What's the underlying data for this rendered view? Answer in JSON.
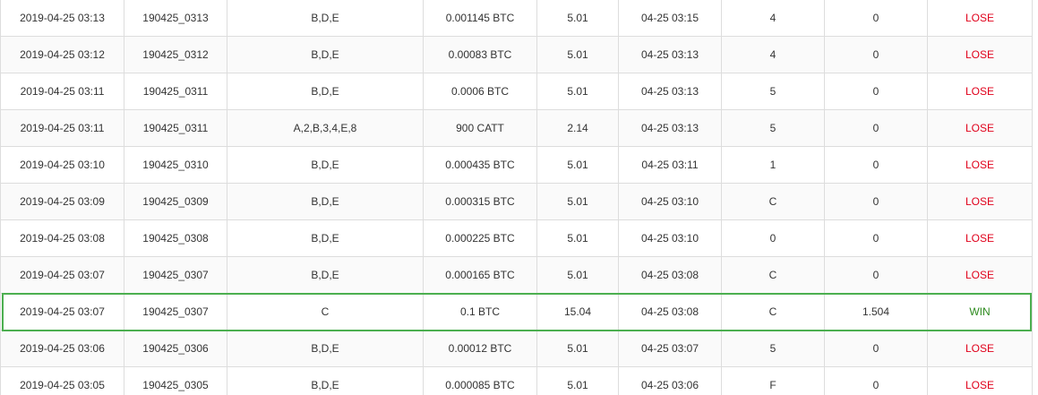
{
  "colors": {
    "lose": "#e0001b",
    "win": "#2e8b1f",
    "highlight_border": "#4caf50",
    "grid": "#dddddd"
  },
  "rows": [
    {
      "time": "2019-04-25 03:13",
      "round": "190425_0313",
      "bet": "B,D,E",
      "amount": "0.001145 BTC",
      "odds": "5.01",
      "draw_time": "04-25 03:15",
      "number": "4",
      "payout": "0",
      "result": "LOSE"
    },
    {
      "time": "2019-04-25 03:12",
      "round": "190425_0312",
      "bet": "B,D,E",
      "amount": "0.00083 BTC",
      "odds": "5.01",
      "draw_time": "04-25 03:13",
      "number": "4",
      "payout": "0",
      "result": "LOSE"
    },
    {
      "time": "2019-04-25 03:11",
      "round": "190425_0311",
      "bet": "B,D,E",
      "amount": "0.0006 BTC",
      "odds": "5.01",
      "draw_time": "04-25 03:13",
      "number": "5",
      "payout": "0",
      "result": "LOSE"
    },
    {
      "time": "2019-04-25 03:11",
      "round": "190425_0311",
      "bet": "A,2,B,3,4,E,8",
      "amount": "900 CATT",
      "odds": "2.14",
      "draw_time": "04-25 03:13",
      "number": "5",
      "payout": "0",
      "result": "LOSE"
    },
    {
      "time": "2019-04-25 03:10",
      "round": "190425_0310",
      "bet": "B,D,E",
      "amount": "0.000435 BTC",
      "odds": "5.01",
      "draw_time": "04-25 03:11",
      "number": "1",
      "payout": "0",
      "result": "LOSE"
    },
    {
      "time": "2019-04-25 03:09",
      "round": "190425_0309",
      "bet": "B,D,E",
      "amount": "0.000315 BTC",
      "odds": "5.01",
      "draw_time": "04-25 03:10",
      "number": "C",
      "payout": "0",
      "result": "LOSE"
    },
    {
      "time": "2019-04-25 03:08",
      "round": "190425_0308",
      "bet": "B,D,E",
      "amount": "0.000225 BTC",
      "odds": "5.01",
      "draw_time": "04-25 03:10",
      "number": "0",
      "payout": "0",
      "result": "LOSE"
    },
    {
      "time": "2019-04-25 03:07",
      "round": "190425_0307",
      "bet": "B,D,E",
      "amount": "0.000165 BTC",
      "odds": "5.01",
      "draw_time": "04-25 03:08",
      "number": "C",
      "payout": "0",
      "result": "LOSE"
    },
    {
      "time": "2019-04-25 03:07",
      "round": "190425_0307",
      "bet": "C",
      "amount": "0.1 BTC",
      "odds": "15.04",
      "draw_time": "04-25 03:08",
      "number": "C",
      "payout": "1.504",
      "result": "WIN",
      "highlighted": true
    },
    {
      "time": "2019-04-25 03:06",
      "round": "190425_0306",
      "bet": "B,D,E",
      "amount": "0.00012 BTC",
      "odds": "5.01",
      "draw_time": "04-25 03:07",
      "number": "5",
      "payout": "0",
      "result": "LOSE"
    },
    {
      "time": "2019-04-25 03:05",
      "round": "190425_0305",
      "bet": "B,D,E",
      "amount": "0.000085 BTC",
      "odds": "5.01",
      "draw_time": "04-25 03:06",
      "number": "F",
      "payout": "0",
      "result": "LOSE"
    }
  ]
}
